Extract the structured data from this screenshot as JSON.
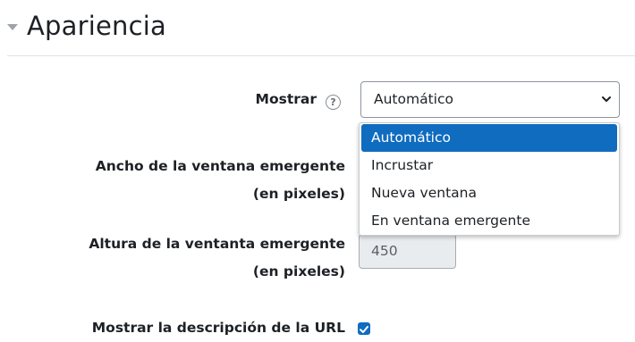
{
  "section": {
    "title": "Apariencia"
  },
  "fields": {
    "mostrar": {
      "label": "Mostrar",
      "help_icon": "question-circle-icon",
      "value": "Automático",
      "options": [
        "Automático",
        "Incrustar",
        "Nueva ventana",
        "En ventana emergente"
      ],
      "highlighted_option": "Automático"
    },
    "popup_width": {
      "label_line1": "Ancho de la ventana emergente",
      "label_line2": "(en pixeles)"
    },
    "popup_height": {
      "label_line1": "Altura de la ventanta emergente",
      "label_line2": "(en pixeles)",
      "value": "450"
    },
    "show_description": {
      "label": "Mostrar la descripción de la URL",
      "checked": true
    }
  },
  "colors": {
    "accent": "#0f6cbf",
    "disabled_input_bg": "#e9ecef",
    "divider": "#dee2e6"
  }
}
